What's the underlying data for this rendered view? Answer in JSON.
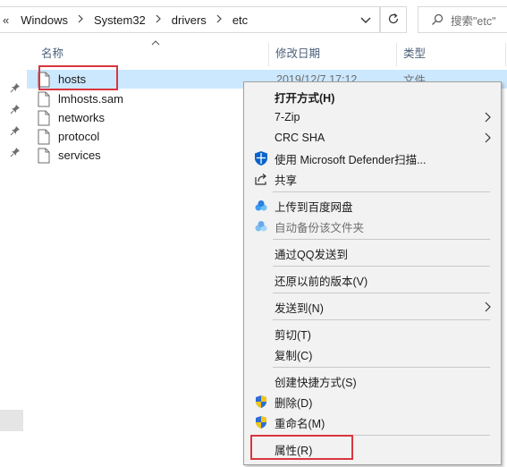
{
  "address_bar": {
    "prefix": "«",
    "crumbs": [
      "Windows",
      "System32",
      "drivers",
      "etc"
    ],
    "search_placeholder": "搜索\"etc\""
  },
  "columns": {
    "name": "名称",
    "date_modified": "修改日期",
    "type": "类型"
  },
  "files": [
    {
      "name": "hosts",
      "date": "2019/12/7 17:12",
      "type": "文件"
    },
    {
      "name": "lmhosts.sam"
    },
    {
      "name": "networks"
    },
    {
      "name": "protocol"
    },
    {
      "name": "services"
    }
  ],
  "context_menu": {
    "open_with": "打开方式(H)",
    "seven_zip": "7-Zip",
    "crc_sha": "CRC SHA",
    "defender_scan": "使用 Microsoft Defender扫描...",
    "share": "共享",
    "upload_baidu": "上传到百度网盘",
    "auto_backup": "自动备份该文件夹",
    "send_qq": "通过QQ发送到",
    "restore_previous": "还原以前的版本(V)",
    "send_to": "发送到(N)",
    "cut": "剪切(T)",
    "copy": "复制(C)",
    "create_shortcut": "创建快捷方式(S)",
    "delete": "删除(D)",
    "rename": "重命名(M)",
    "properties": "属性(R)"
  },
  "colors": {
    "selection": "#cce8ff",
    "highlight_border": "#d9363e",
    "menu_bg": "#f2f2f2",
    "defender_blue": "#0a63c9",
    "baidu_blue": "#3c9cf0"
  }
}
